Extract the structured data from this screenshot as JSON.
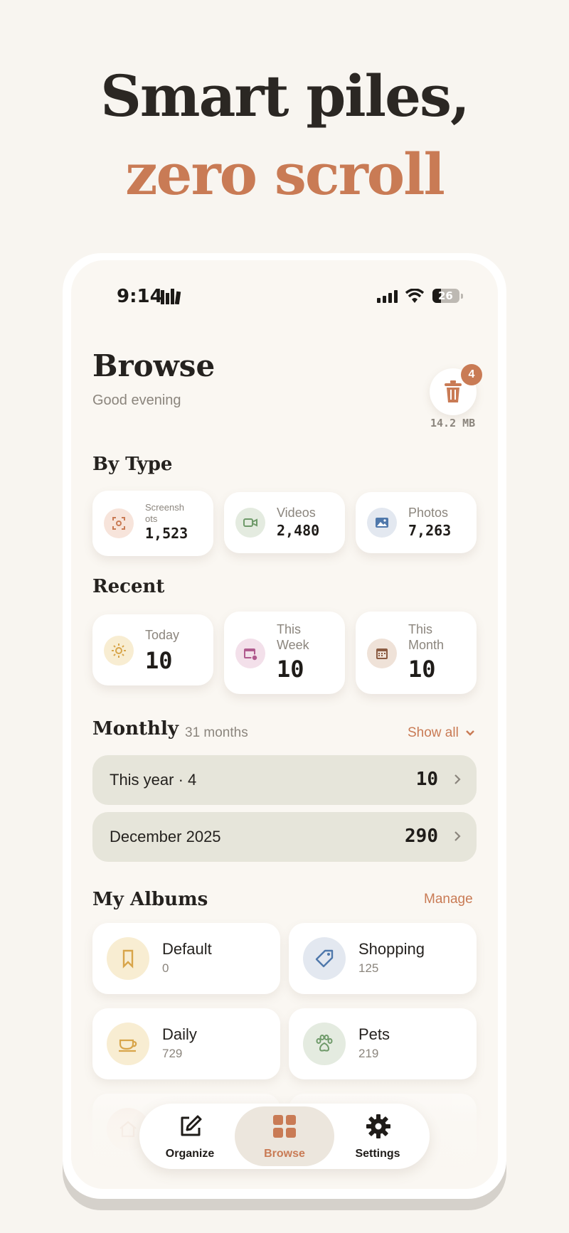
{
  "headline": {
    "line1": "Smart piles,",
    "line2": "zero scroll"
  },
  "status_bar": {
    "time": "9:14",
    "battery": "26"
  },
  "header": {
    "title": "Browse",
    "greeting": "Good evening",
    "trash_badge": "4",
    "trash_size": "14.2 MB"
  },
  "by_type": {
    "title": "By Type",
    "items": [
      {
        "label": "Screensh\nots",
        "count": "1,523",
        "icon": "screenshot-icon"
      },
      {
        "label": "Videos",
        "count": "2,480",
        "icon": "video-icon"
      },
      {
        "label": "Photos",
        "count": "7,263",
        "icon": "photo-icon"
      }
    ]
  },
  "recent": {
    "title": "Recent",
    "items": [
      {
        "label": "Today",
        "count": "10",
        "icon": "sun-icon"
      },
      {
        "label": "This\nWeek",
        "count": "10",
        "icon": "calendar-week-icon"
      },
      {
        "label": "This\nMonth",
        "count": "10",
        "icon": "calendar-month-icon"
      }
    ]
  },
  "monthly": {
    "title": "Monthly",
    "subtitle": "31 months",
    "show_all": "Show all",
    "rows": [
      {
        "label": "This year · 4",
        "count": "10"
      },
      {
        "label": "December 2025",
        "count": "290"
      }
    ]
  },
  "albums": {
    "title": "My Albums",
    "manage": "Manage",
    "items": [
      {
        "name": "Default",
        "count": "0",
        "icon": "bookmark-icon"
      },
      {
        "name": "Shopping",
        "count": "125",
        "icon": "tag-icon"
      },
      {
        "name": "Daily",
        "count": "729",
        "icon": "cup-icon"
      },
      {
        "name": "Pets",
        "count": "219",
        "icon": "paw-icon"
      }
    ]
  },
  "tabbar": {
    "organize": "Organize",
    "browse": "Browse",
    "settings": "Settings"
  },
  "colors": {
    "accent": "#c97b55",
    "background": "#faf7f2",
    "row_bg": "#e6e5da"
  }
}
